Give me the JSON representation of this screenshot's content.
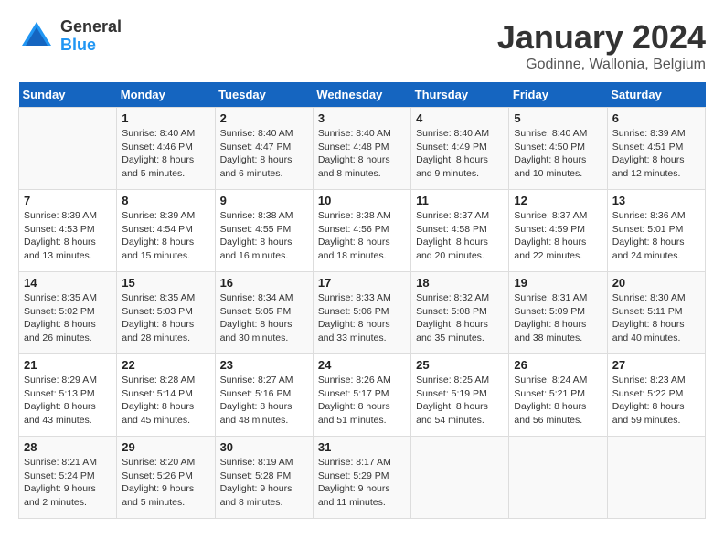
{
  "logo": {
    "general": "General",
    "blue": "Blue"
  },
  "header": {
    "month": "January 2024",
    "location": "Godinne, Wallonia, Belgium"
  },
  "weekdays": [
    "Sunday",
    "Monday",
    "Tuesday",
    "Wednesday",
    "Thursday",
    "Friday",
    "Saturday"
  ],
  "weeks": [
    [
      {
        "day": "",
        "sunrise": "",
        "sunset": "",
        "daylight": ""
      },
      {
        "day": "1",
        "sunrise": "Sunrise: 8:40 AM",
        "sunset": "Sunset: 4:46 PM",
        "daylight": "Daylight: 8 hours and 5 minutes."
      },
      {
        "day": "2",
        "sunrise": "Sunrise: 8:40 AM",
        "sunset": "Sunset: 4:47 PM",
        "daylight": "Daylight: 8 hours and 6 minutes."
      },
      {
        "day": "3",
        "sunrise": "Sunrise: 8:40 AM",
        "sunset": "Sunset: 4:48 PM",
        "daylight": "Daylight: 8 hours and 8 minutes."
      },
      {
        "day": "4",
        "sunrise": "Sunrise: 8:40 AM",
        "sunset": "Sunset: 4:49 PM",
        "daylight": "Daylight: 8 hours and 9 minutes."
      },
      {
        "day": "5",
        "sunrise": "Sunrise: 8:40 AM",
        "sunset": "Sunset: 4:50 PM",
        "daylight": "Daylight: 8 hours and 10 minutes."
      },
      {
        "day": "6",
        "sunrise": "Sunrise: 8:39 AM",
        "sunset": "Sunset: 4:51 PM",
        "daylight": "Daylight: 8 hours and 12 minutes."
      }
    ],
    [
      {
        "day": "7",
        "sunrise": "Sunrise: 8:39 AM",
        "sunset": "Sunset: 4:53 PM",
        "daylight": "Daylight: 8 hours and 13 minutes."
      },
      {
        "day": "8",
        "sunrise": "Sunrise: 8:39 AM",
        "sunset": "Sunset: 4:54 PM",
        "daylight": "Daylight: 8 hours and 15 minutes."
      },
      {
        "day": "9",
        "sunrise": "Sunrise: 8:38 AM",
        "sunset": "Sunset: 4:55 PM",
        "daylight": "Daylight: 8 hours and 16 minutes."
      },
      {
        "day": "10",
        "sunrise": "Sunrise: 8:38 AM",
        "sunset": "Sunset: 4:56 PM",
        "daylight": "Daylight: 8 hours and 18 minutes."
      },
      {
        "day": "11",
        "sunrise": "Sunrise: 8:37 AM",
        "sunset": "Sunset: 4:58 PM",
        "daylight": "Daylight: 8 hours and 20 minutes."
      },
      {
        "day": "12",
        "sunrise": "Sunrise: 8:37 AM",
        "sunset": "Sunset: 4:59 PM",
        "daylight": "Daylight: 8 hours and 22 minutes."
      },
      {
        "day": "13",
        "sunrise": "Sunrise: 8:36 AM",
        "sunset": "Sunset: 5:01 PM",
        "daylight": "Daylight: 8 hours and 24 minutes."
      }
    ],
    [
      {
        "day": "14",
        "sunrise": "Sunrise: 8:35 AM",
        "sunset": "Sunset: 5:02 PM",
        "daylight": "Daylight: 8 hours and 26 minutes."
      },
      {
        "day": "15",
        "sunrise": "Sunrise: 8:35 AM",
        "sunset": "Sunset: 5:03 PM",
        "daylight": "Daylight: 8 hours and 28 minutes."
      },
      {
        "day": "16",
        "sunrise": "Sunrise: 8:34 AM",
        "sunset": "Sunset: 5:05 PM",
        "daylight": "Daylight: 8 hours and 30 minutes."
      },
      {
        "day": "17",
        "sunrise": "Sunrise: 8:33 AM",
        "sunset": "Sunset: 5:06 PM",
        "daylight": "Daylight: 8 hours and 33 minutes."
      },
      {
        "day": "18",
        "sunrise": "Sunrise: 8:32 AM",
        "sunset": "Sunset: 5:08 PM",
        "daylight": "Daylight: 8 hours and 35 minutes."
      },
      {
        "day": "19",
        "sunrise": "Sunrise: 8:31 AM",
        "sunset": "Sunset: 5:09 PM",
        "daylight": "Daylight: 8 hours and 38 minutes."
      },
      {
        "day": "20",
        "sunrise": "Sunrise: 8:30 AM",
        "sunset": "Sunset: 5:11 PM",
        "daylight": "Daylight: 8 hours and 40 minutes."
      }
    ],
    [
      {
        "day": "21",
        "sunrise": "Sunrise: 8:29 AM",
        "sunset": "Sunset: 5:13 PM",
        "daylight": "Daylight: 8 hours and 43 minutes."
      },
      {
        "day": "22",
        "sunrise": "Sunrise: 8:28 AM",
        "sunset": "Sunset: 5:14 PM",
        "daylight": "Daylight: 8 hours and 45 minutes."
      },
      {
        "day": "23",
        "sunrise": "Sunrise: 8:27 AM",
        "sunset": "Sunset: 5:16 PM",
        "daylight": "Daylight: 8 hours and 48 minutes."
      },
      {
        "day": "24",
        "sunrise": "Sunrise: 8:26 AM",
        "sunset": "Sunset: 5:17 PM",
        "daylight": "Daylight: 8 hours and 51 minutes."
      },
      {
        "day": "25",
        "sunrise": "Sunrise: 8:25 AM",
        "sunset": "Sunset: 5:19 PM",
        "daylight": "Daylight: 8 hours and 54 minutes."
      },
      {
        "day": "26",
        "sunrise": "Sunrise: 8:24 AM",
        "sunset": "Sunset: 5:21 PM",
        "daylight": "Daylight: 8 hours and 56 minutes."
      },
      {
        "day": "27",
        "sunrise": "Sunrise: 8:23 AM",
        "sunset": "Sunset: 5:22 PM",
        "daylight": "Daylight: 8 hours and 59 minutes."
      }
    ],
    [
      {
        "day": "28",
        "sunrise": "Sunrise: 8:21 AM",
        "sunset": "Sunset: 5:24 PM",
        "daylight": "Daylight: 9 hours and 2 minutes."
      },
      {
        "day": "29",
        "sunrise": "Sunrise: 8:20 AM",
        "sunset": "Sunset: 5:26 PM",
        "daylight": "Daylight: 9 hours and 5 minutes."
      },
      {
        "day": "30",
        "sunrise": "Sunrise: 8:19 AM",
        "sunset": "Sunset: 5:28 PM",
        "daylight": "Daylight: 9 hours and 8 minutes."
      },
      {
        "day": "31",
        "sunrise": "Sunrise: 8:17 AM",
        "sunset": "Sunset: 5:29 PM",
        "daylight": "Daylight: 9 hours and 11 minutes."
      },
      {
        "day": "",
        "sunrise": "",
        "sunset": "",
        "daylight": ""
      },
      {
        "day": "",
        "sunrise": "",
        "sunset": "",
        "daylight": ""
      },
      {
        "day": "",
        "sunrise": "",
        "sunset": "",
        "daylight": ""
      }
    ]
  ]
}
